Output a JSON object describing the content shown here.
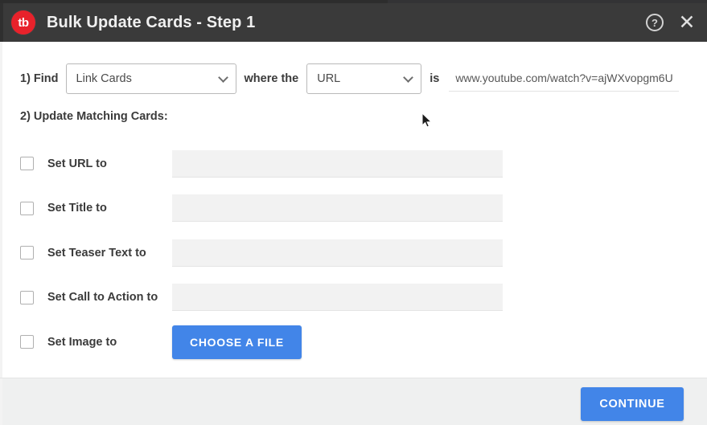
{
  "header": {
    "logo_text": "tb",
    "logo_name": "tb-logo-icon",
    "title": "Bulk Update Cards - Step 1",
    "help_glyph": "?",
    "close_glyph": "✕",
    "bg_color": "#3a3a3a",
    "brand_color": "#e8222b"
  },
  "find_row": {
    "find_label": "1) Find",
    "card_type_value": "Link Cards",
    "where_label": "where the",
    "field_value": "URL",
    "is_label": "is",
    "match_value": "www.youtube.com/watch?v=ajWXvopgm6U",
    "match_placeholder": ""
  },
  "update_section": {
    "heading": "2) Update Matching Cards:",
    "rows": [
      {
        "label": "Set URL to",
        "checked": false,
        "value": "",
        "placeholder": "",
        "control": "input"
      },
      {
        "label": "Set Title to",
        "checked": false,
        "value": "",
        "placeholder": "",
        "control": "input"
      },
      {
        "label": "Set Teaser Text to",
        "checked": false,
        "value": "",
        "placeholder": "",
        "control": "input"
      },
      {
        "label": "Set Call to Action to",
        "checked": false,
        "value": "",
        "placeholder": "",
        "control": "input"
      },
      {
        "label": "Set Image to",
        "checked": false,
        "value": "",
        "placeholder": "",
        "control": "button",
        "button_label": "CHOOSE A FILE"
      }
    ]
  },
  "footer": {
    "continue_label": "CONTINUE",
    "accent_color": "#4285e8",
    "bg_color": "#eff0f0"
  }
}
